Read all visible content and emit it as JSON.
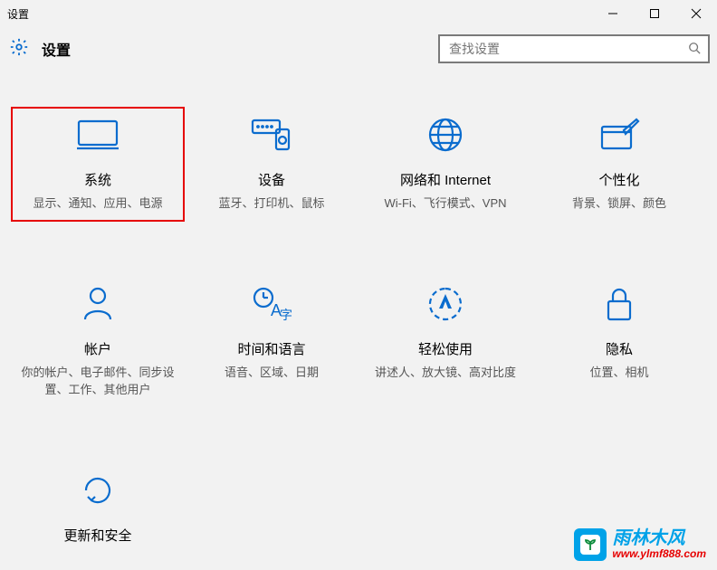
{
  "window": {
    "title": "设置"
  },
  "header": {
    "title": "设置",
    "search_placeholder": "查找设置"
  },
  "tiles": [
    {
      "title": "系统",
      "desc": "显示、通知、应用、电源",
      "highlighted": true
    },
    {
      "title": "设备",
      "desc": "蓝牙、打印机、鼠标"
    },
    {
      "title": "网络和 Internet",
      "desc": "Wi-Fi、飞行模式、VPN"
    },
    {
      "title": "个性化",
      "desc": "背景、锁屏、颜色"
    },
    {
      "title": "帐户",
      "desc": "你的帐户、电子邮件、同步设置、工作、其他用户"
    },
    {
      "title": "时间和语言",
      "desc": "语音、区域、日期"
    },
    {
      "title": "轻松使用",
      "desc": "讲述人、放大镜、高对比度"
    },
    {
      "title": "隐私",
      "desc": "位置、相机"
    },
    {
      "title": "更新和安全",
      "desc": ""
    }
  ],
  "watermark": {
    "brand": "雨林木风",
    "url": "www.ylmf888.com"
  }
}
